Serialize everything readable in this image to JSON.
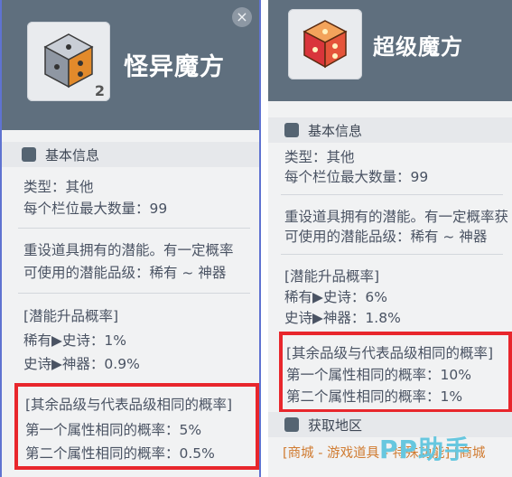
{
  "left_panel": {
    "title": "怪异魔方",
    "quantity": "2",
    "close_icon": "×",
    "section_basic": "基本信息",
    "type_line": "类型：其他",
    "max_line": "每个栏位最大数量：99",
    "desc_line1": "重设道具拥有的潜能。有一定概率",
    "desc_line2": "可使用的潜能品级：稀有 ~ 神器",
    "upgrade_title": "[潜能升品概率]",
    "upgrade_1": "稀有▶史诗：1%",
    "upgrade_2": "史诗▶神器：0.9%",
    "same_title": "[其余品级与代表品级相同的概率]",
    "same_1": "第一个属性相同的概率：5%",
    "same_2": "第二个属性相同的概率：0.5%"
  },
  "right_panel": {
    "title": "超级魔方",
    "section_basic": "基本信息",
    "type_line": "类型：其他",
    "max_line": "每个栏位最大数量：99",
    "desc_line1": "重设道具拥有的潜能。有一定概率获",
    "desc_line2": "可使用的潜能品级：稀有 ~ 神器",
    "upgrade_title": "[潜能升品概率]",
    "upgrade_1": "稀有▶史诗：6%",
    "upgrade_2": "史诗▶神器：1.8%",
    "same_title": "[其余品级与代表品级相同的概率]",
    "same_1": "第一个属性相同的概率：10%",
    "same_2": "第二个属性相同的概率：1%",
    "section_get": "获取地区",
    "source": "[商城 - 游戏道具 - 特殊功能] [商城"
  },
  "watermark": "PP助手",
  "colors": {
    "header": "#5f6f7e",
    "highlight": "#e8262c",
    "source_text": "#d07b30"
  },
  "icons": {
    "left_item": "weird-cube-icon",
    "right_item": "super-cube-icon",
    "section": "bag-icon",
    "location": "location-pin-icon"
  }
}
